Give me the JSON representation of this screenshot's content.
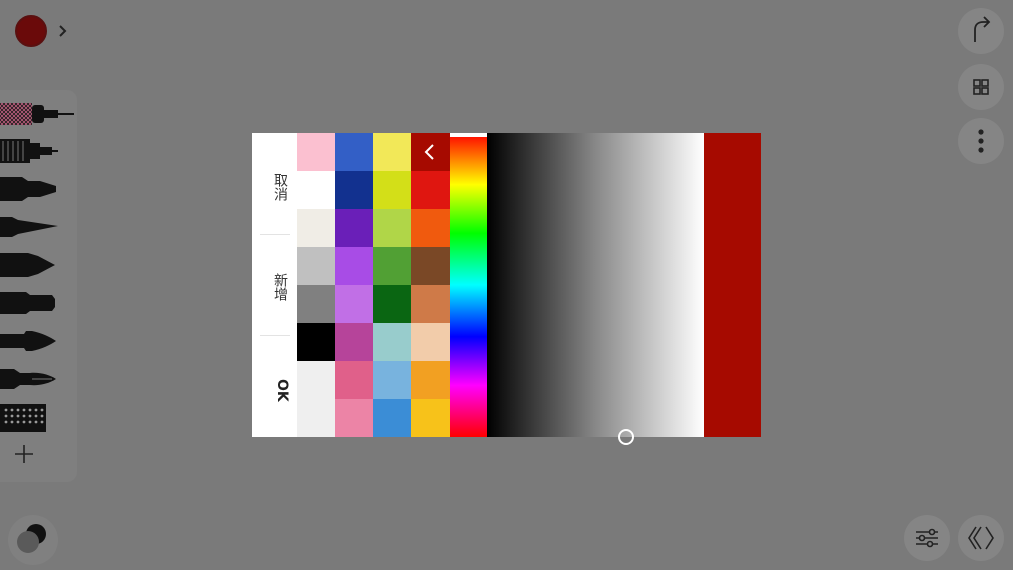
{
  "current_color": "#6a0a0a",
  "icons": {
    "expand": "chevron-right-icon",
    "add_brush": "plus-icon",
    "layers": "layers-icon",
    "share": "share-icon",
    "gallery": "grid-icon",
    "more": "more-vertical-icon",
    "adjust": "sliders-icon",
    "symmetry": "symmetry-icon",
    "back": "chevron-left-icon"
  },
  "brushes": [
    "technical-pen",
    "airbrush",
    "marker",
    "pen-nib",
    "chisel-marker",
    "fat-marker",
    "round-brush",
    "fountain-pen",
    "texture-brush"
  ],
  "picker": {
    "cancel_label": "取消",
    "add_label": "新增",
    "ok_label": "OK",
    "selected_color": "#a60a00",
    "hue_position": 0.0,
    "brightness_position": 0.64,
    "swatch_columns": [
      [
        "#fbc0d0",
        "#ffffff",
        "#f0ede6",
        "#c0c0c0",
        "#808080",
        "#000000",
        "#efefef",
        "#efefef"
      ],
      [
        "#335fc6",
        "#12318f",
        "#6a1fb8",
        "#a84ce6",
        "#c16fe6",
        "#b6449a",
        "#e0608a",
        "#ec84a6"
      ],
      [
        "#f2e858",
        "#d3df18",
        "#b0d648",
        "#51a034",
        "#0a6612",
        "#98cccc",
        "#78b3de",
        "#3b8dd6"
      ],
      [
        "#a60a00",
        "#df1610",
        "#f05a0e",
        "#7a4826",
        "#cf7a48",
        "#f2ccaa",
        "#f2a022",
        "#f7c21a"
      ]
    ]
  }
}
